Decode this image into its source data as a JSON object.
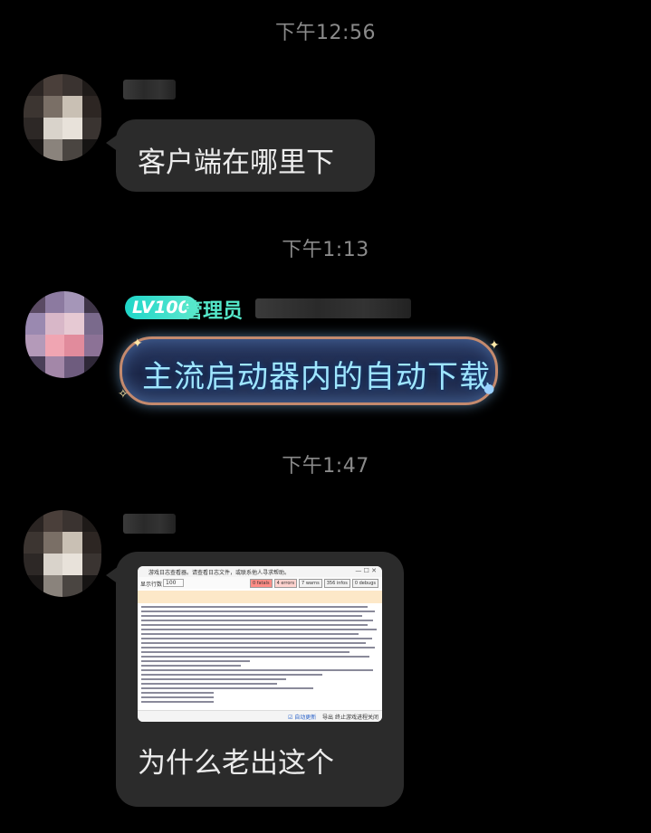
{
  "messages": {
    "t1": "下午12:56",
    "m1_text": "客户端在哪里下",
    "t2": "下午1:13",
    "badge_level": "LV100",
    "badge_role": "管理员",
    "m2_text": "主流启动器内的自动下载",
    "t3": "下午1:47",
    "m3_text": "为什么老出这个"
  },
  "screenshot": {
    "title": "游戏日志查看器。请查看日志文件，或联系他人寻求帮助。",
    "filter_label": "显示行数",
    "filter_value": "100",
    "tabs": [
      "0 fatals",
      "4 errors",
      "7 warns",
      "356 infos",
      "0 debugs"
    ],
    "footer_checkbox": "自动更新",
    "footer_links": [
      "导出",
      "终止游戏进程",
      "关闭"
    ]
  },
  "colors": {
    "bubble": "#2b2b2b",
    "timestamp": "#8a8a8a",
    "badge": "#1fd6c8",
    "role_text": "#54e7c9",
    "fancy_text": "#9fe6ff"
  }
}
